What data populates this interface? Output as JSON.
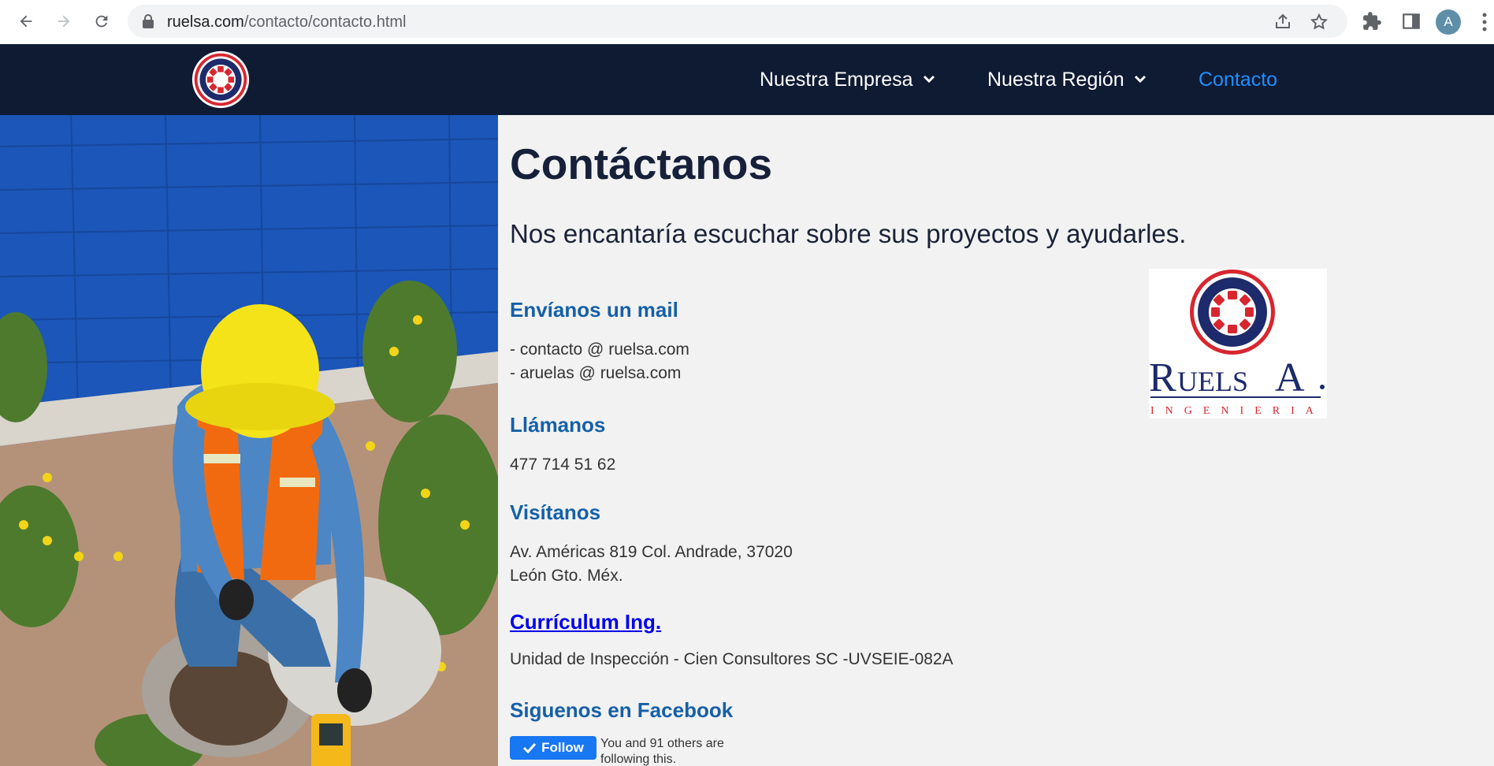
{
  "browser": {
    "url_domain": "ruelsa.com",
    "url_path": "/contacto/contacto.html",
    "profile_initial": "A",
    "icons": [
      "back-icon",
      "forward-icon",
      "reload-icon",
      "lock-icon",
      "share-icon",
      "star-icon",
      "extensions-icon",
      "side-panel-icon",
      "menu-icon"
    ]
  },
  "nav": {
    "items": [
      {
        "label": "Nuestra Empresa",
        "has_dropdown": true
      },
      {
        "label": "Nuestra Región",
        "has_dropdown": true
      },
      {
        "label": "Contacto",
        "active": true
      }
    ]
  },
  "main": {
    "title": "Contáctanos",
    "subtitle": "Nos encantaría escuchar sobre sus proyectos y ayudarles.",
    "sections": {
      "mail": {
        "title": "Envíanos un mail",
        "lines": [
          "- contacto @ ruelsa.com",
          "- aruelas @ ruelsa.com"
        ]
      },
      "call": {
        "title": "Llámanos",
        "lines": [
          "477 714 51 62"
        ]
      },
      "visit": {
        "title": "Visítanos",
        "lines": [
          "Av. Américas 819 Col. Andrade, 37020",
          "León Gto. Méx."
        ]
      },
      "cv": {
        "title": "Currículum Ing.",
        "lines": [
          "Unidad de Inspección - Cien Consultores SC -UVSEIE-082A"
        ]
      },
      "facebook": {
        "title": "Siguenos en Facebook",
        "button": "Follow",
        "social_text": "You and 91 others are following this."
      }
    },
    "brand_logo": {
      "name": "RUELSA",
      "tagline": "INGENIERIA"
    }
  },
  "colors": {
    "header_bg": "#0f1a33",
    "accent_blue": "#1560a8",
    "active_link": "#1e90ff",
    "facebook_blue": "#1877f2",
    "logo_red": "#d8262f",
    "logo_navy": "#1d2a6b"
  }
}
